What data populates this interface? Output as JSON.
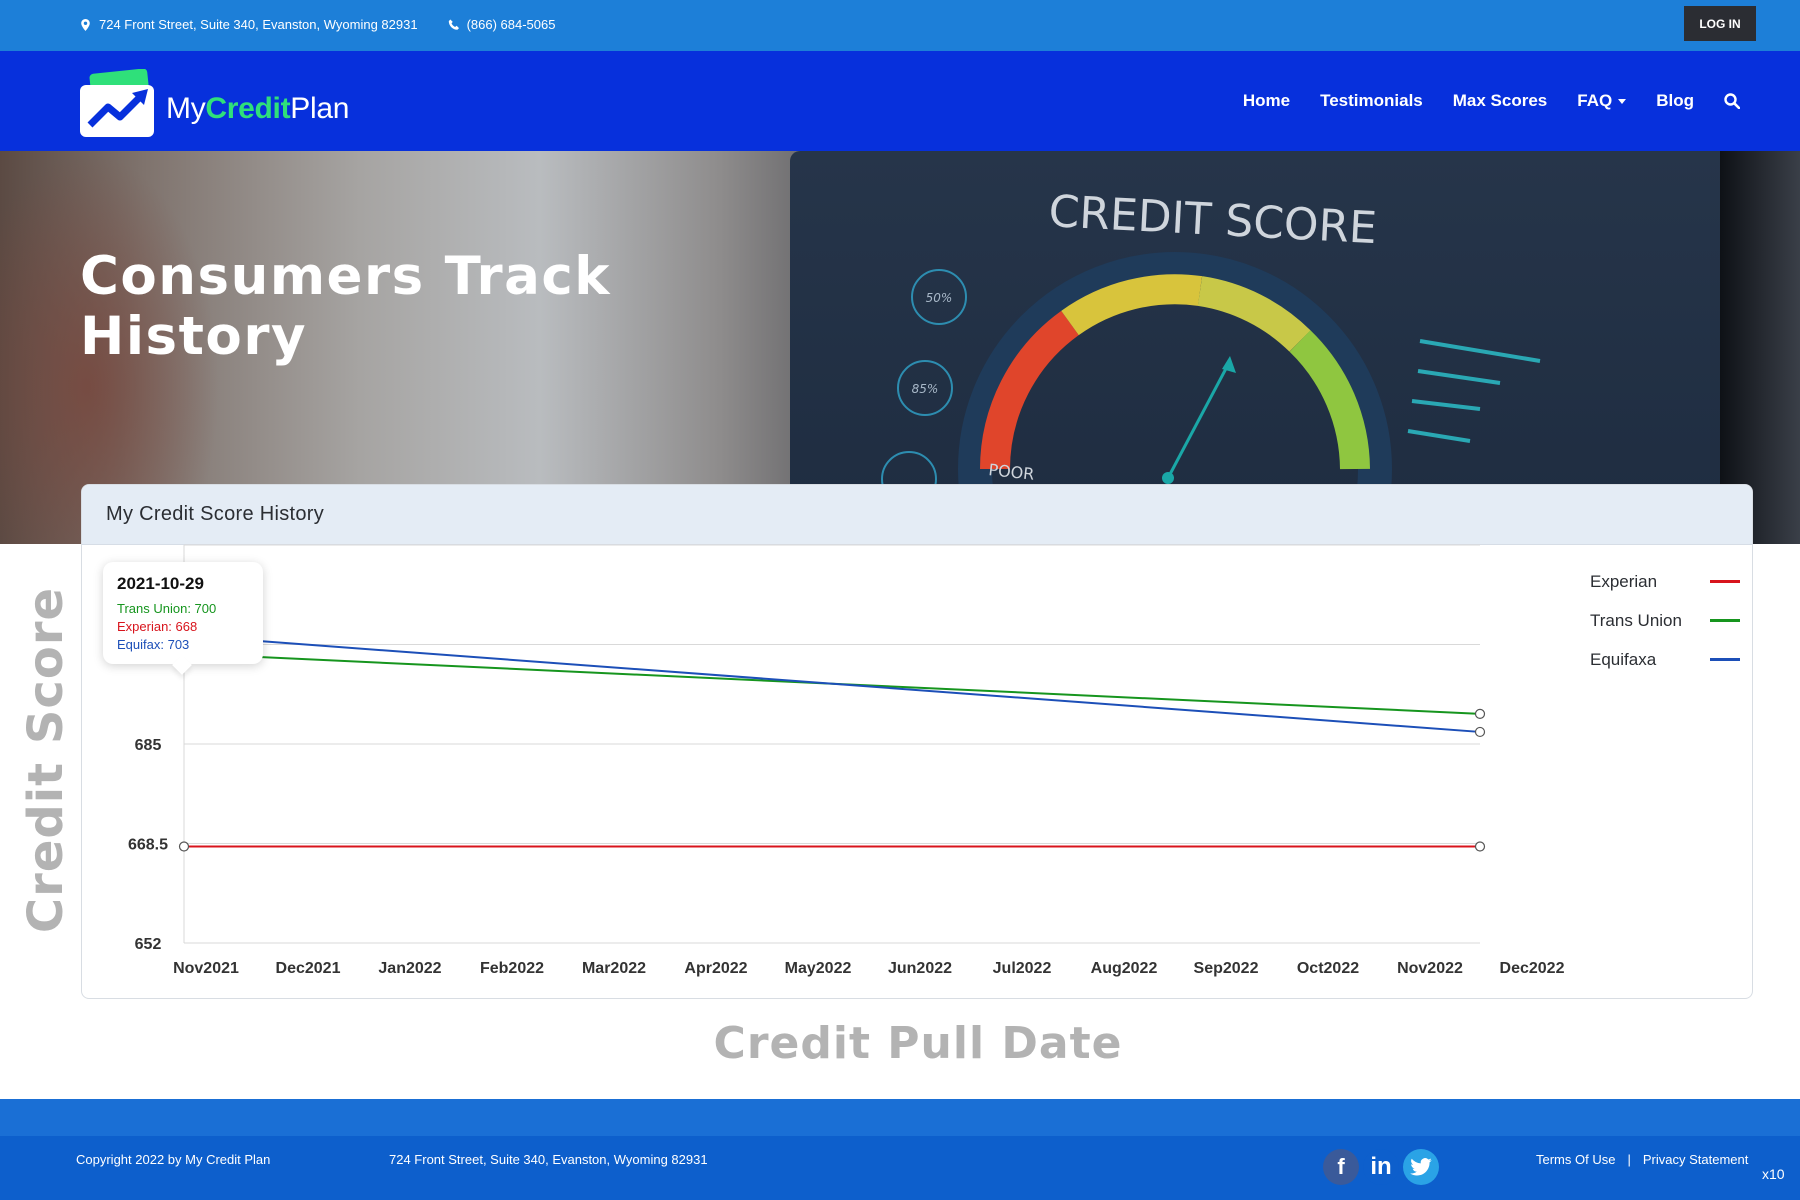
{
  "topbar": {
    "address": "724 Front Street, Suite 340, Evanston, Wyoming 82931",
    "phone": "(866) 684-5065",
    "login_label": "LOG IN"
  },
  "brand": {
    "name_prefix": "My",
    "name_accent": "Credit",
    "name_suffix": "Plan",
    "accent_color": "#2fe07a"
  },
  "nav": {
    "items": [
      {
        "label": "Home"
      },
      {
        "label": "Testimonials"
      },
      {
        "label": "Max Scores"
      },
      {
        "label": "FAQ"
      },
      {
        "label": "Blog"
      }
    ],
    "search_icon": "search-icon"
  },
  "hero": {
    "title_line1": "Consumers Track",
    "title_line2": "History",
    "image_text": {
      "heading": "CREDIT SCORE",
      "gauge_label": "POOR",
      "bubbles": [
        "50%",
        "85%"
      ]
    }
  },
  "card": {
    "title": "My Credit Score History"
  },
  "tooltip": {
    "date": "2021-10-29",
    "rows": [
      "Trans Union: 700",
      "Experian: 668",
      "Equifax: 703"
    ]
  },
  "chart_data": {
    "type": "line",
    "title": "My Credit Score History",
    "xlabel": "Credit Pull Date",
    "ylabel": "Credit Score",
    "ylim": [
      652,
      718
    ],
    "yticks": [
      652,
      668.5,
      685,
      701.5
    ],
    "grid": true,
    "legend": "top-right",
    "categories": [
      "Nov2021",
      "Dec2021",
      "Jan2022",
      "Feb2022",
      "Mar2022",
      "Apr2022",
      "May2022",
      "Jun2022",
      "Jul2022",
      "Aug2022",
      "Sep2022",
      "Oct2022",
      "Nov2022",
      "Dec2022"
    ],
    "series": [
      {
        "name": "Experian",
        "color": "#d8141c",
        "points": [
          {
            "x": "2021-10-29",
            "y": 668
          },
          {
            "x": "2022-12",
            "y": 668
          }
        ]
      },
      {
        "name": "Trans Union",
        "color": "#16951e",
        "points": [
          {
            "x": "2021-10-29",
            "y": 700
          },
          {
            "x": "2022-12",
            "y": 690
          }
        ]
      },
      {
        "name": "Equifaxa",
        "color": "#1c4fb8",
        "points": [
          {
            "x": "2021-10-29",
            "y": 703
          },
          {
            "x": "2022-12",
            "y": 687
          }
        ]
      }
    ]
  },
  "footer": {
    "copyright": "Copyright 2022 by My Credit Plan",
    "address": "724 Front Street, Suite 340, Evanston, Wyoming 82931",
    "social_icons": [
      "facebook-icon",
      "linkedin-icon",
      "twitter-icon"
    ],
    "terms": "Terms Of Use",
    "separator": "|",
    "privacy": "Privacy Statement",
    "zoom": "x10"
  }
}
